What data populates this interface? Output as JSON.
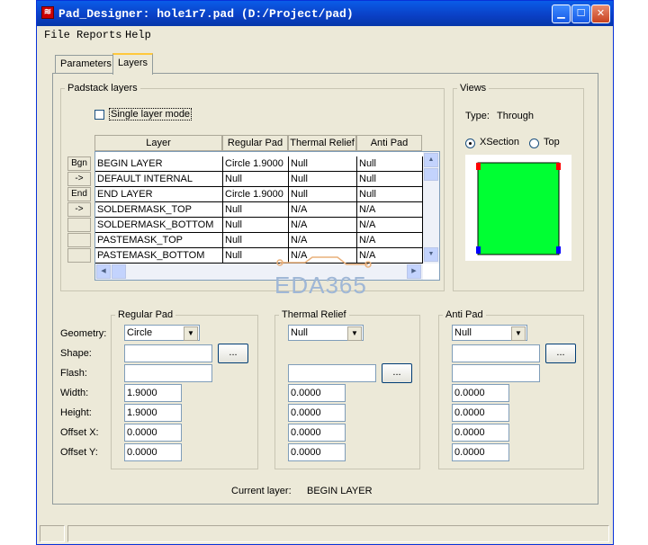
{
  "window": {
    "title": "Pad_Designer: hole1r7.pad (D:/Project/pad)"
  },
  "menu": {
    "file": "File",
    "reports": "Reports",
    "help": "Help"
  },
  "tabs": {
    "parameters": "Parameters",
    "layers": "Layers"
  },
  "padstack": {
    "group_label": "Padstack layers",
    "single_layer_label": "Single layer mode",
    "single_layer_checked": false,
    "columns": [
      "Layer",
      "Regular Pad",
      "Thermal Relief",
      "Anti Pad"
    ],
    "row_buttons": [
      "Bgn",
      "->",
      "End",
      "->",
      "",
      "",
      ""
    ],
    "rows": [
      [
        "BEGIN LAYER",
        "Circle 1.9000",
        "Null",
        "Null"
      ],
      [
        "DEFAULT INTERNAL",
        "Null",
        "Null",
        "Null"
      ],
      [
        "END LAYER",
        "Circle 1.9000",
        "Null",
        "Null"
      ],
      [
        "SOLDERMASK_TOP",
        "Null",
        "N/A",
        "N/A"
      ],
      [
        "SOLDERMASK_BOTTOM",
        "Null",
        "N/A",
        "N/A"
      ],
      [
        "PASTEMASK_TOP",
        "Null",
        "N/A",
        "N/A"
      ],
      [
        "PASTEMASK_BOTTOM",
        "Null",
        "N/A",
        "N/A"
      ]
    ]
  },
  "views": {
    "group_label": "Views",
    "type_label": "Type:",
    "type_value": "Through",
    "xsection_label": "XSection",
    "top_label": "Top",
    "selected": "XSection",
    "colors": {
      "pad": "#00ff33",
      "top_marker": "#ff0000",
      "bottom_marker": "#0000ff",
      "outline": "#000000"
    }
  },
  "watermark": "EDA365",
  "field_labels": {
    "geometry": "Geometry:",
    "shape": "Shape:",
    "flash": "Flash:",
    "width": "Width:",
    "height": "Height:",
    "offset_x": "Offset X:",
    "offset_y": "Offset Y:"
  },
  "regular_pad": {
    "label": "Regular Pad",
    "geometry": "Circle",
    "shape": "",
    "flash": "",
    "width": "1.9000",
    "height": "1.9000",
    "offset_x": "0.0000",
    "offset_y": "0.0000",
    "browse": "..."
  },
  "thermal_relief": {
    "label": "Thermal Relief",
    "geometry": "Null",
    "flash": "",
    "width": "0.0000",
    "height": "0.0000",
    "offset_x": "0.0000",
    "offset_y": "0.0000",
    "browse": "..."
  },
  "anti_pad": {
    "label": "Anti Pad",
    "geometry": "Null",
    "shape": "",
    "flash": "",
    "width": "0.0000",
    "height": "0.0000",
    "offset_x": "0.0000",
    "offset_y": "0.0000",
    "browse": "..."
  },
  "current_layer": {
    "label": "Current layer:",
    "value": "BEGIN LAYER"
  }
}
